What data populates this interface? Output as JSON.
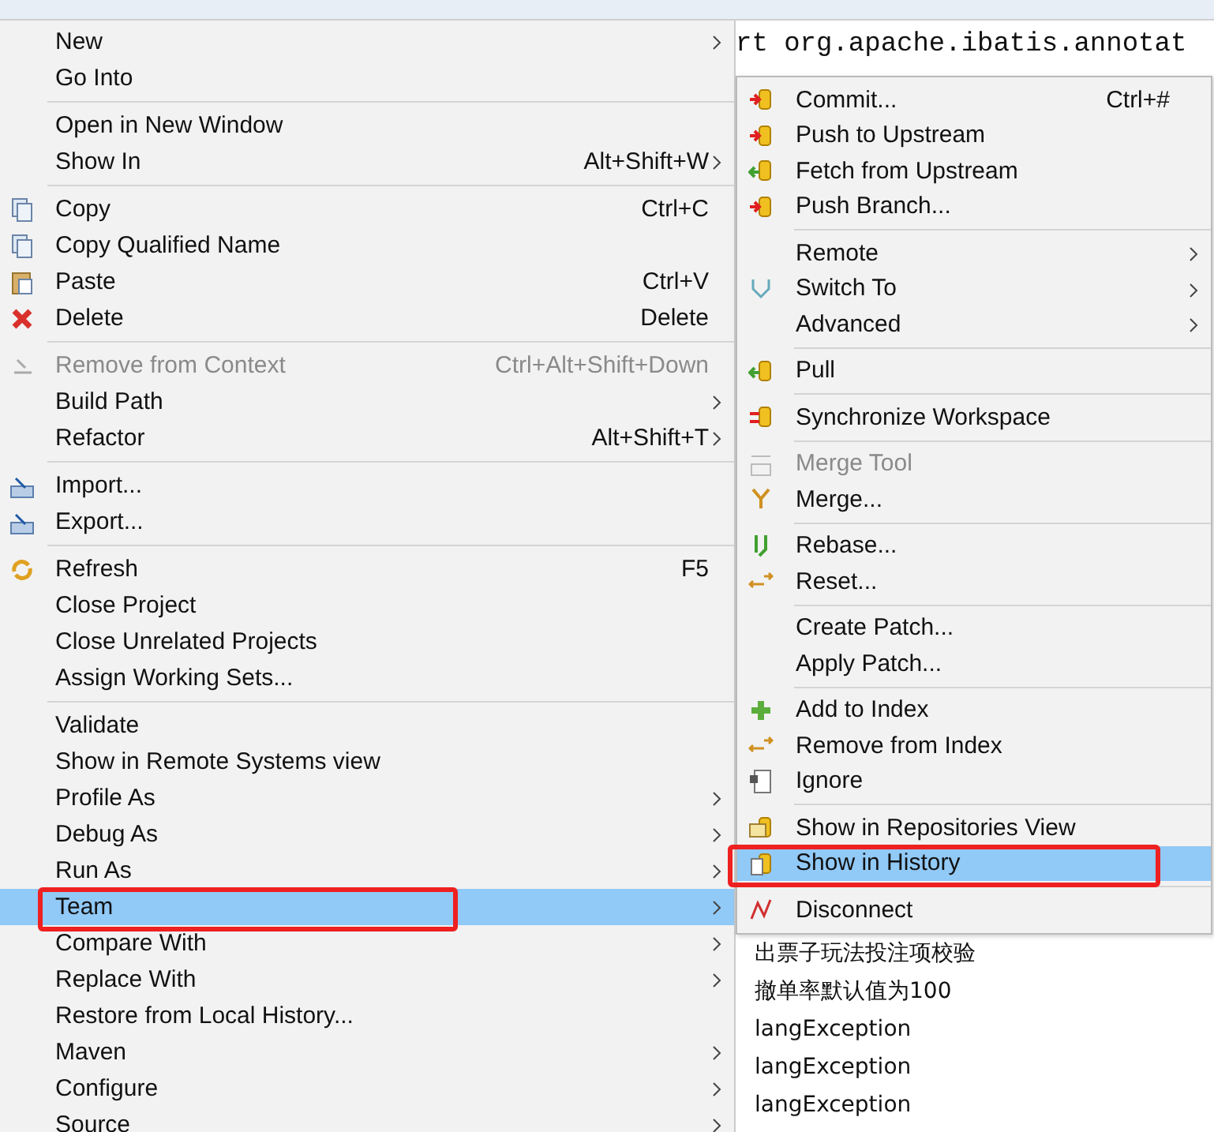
{
  "context_menu": {
    "groups": [
      [
        {
          "label": "New",
          "has_submenu": true,
          "disabled": false,
          "selected": false,
          "circled": false
        },
        {
          "label": "Go Into",
          "has_submenu": false,
          "disabled": false,
          "selected": false,
          "circled": false
        }
      ],
      [
        {
          "label": "Open in New Window",
          "has_submenu": false,
          "disabled": false,
          "selected": false,
          "circled": false
        },
        {
          "label": "Show In",
          "shortcut": "Alt+Shift+W",
          "has_submenu": true,
          "disabled": false,
          "selected": false,
          "circled": false
        }
      ],
      [
        {
          "label": "Copy",
          "shortcut": "Ctrl+C",
          "has_submenu": false,
          "disabled": false,
          "selected": false,
          "circled": false
        },
        {
          "label": "Copy Qualified Name",
          "has_submenu": false,
          "disabled": false,
          "selected": false,
          "circled": false
        },
        {
          "label": "Paste",
          "shortcut": "Ctrl+V",
          "has_submenu": false,
          "disabled": false,
          "selected": false,
          "circled": false
        },
        {
          "label": "Delete",
          "shortcut": "Delete",
          "has_submenu": false,
          "disabled": false,
          "selected": false,
          "circled": false
        }
      ],
      [
        {
          "label": "Remove from Context",
          "shortcut": "Ctrl+Alt+Shift+Down",
          "has_submenu": false,
          "disabled": true,
          "selected": false,
          "circled": false
        },
        {
          "label": "Build Path",
          "has_submenu": true,
          "disabled": false,
          "selected": false,
          "circled": false
        },
        {
          "label": "Refactor",
          "shortcut": "Alt+Shift+T",
          "has_submenu": true,
          "disabled": false,
          "selected": false,
          "circled": false
        }
      ],
      [
        {
          "label": "Import...",
          "has_submenu": false,
          "disabled": false,
          "selected": false,
          "circled": false
        },
        {
          "label": "Export...",
          "has_submenu": false,
          "disabled": false,
          "selected": false,
          "circled": false
        }
      ],
      [
        {
          "label": "Refresh",
          "shortcut": "F5",
          "has_submenu": false,
          "disabled": false,
          "selected": false,
          "circled": false
        },
        {
          "label": "Close Project",
          "has_submenu": false,
          "disabled": false,
          "selected": false,
          "circled": false
        },
        {
          "label": "Close Unrelated Projects",
          "has_submenu": false,
          "disabled": false,
          "selected": false,
          "circled": false
        },
        {
          "label": "Assign Working Sets...",
          "has_submenu": false,
          "disabled": false,
          "selected": false,
          "circled": false
        }
      ],
      [
        {
          "label": "Validate",
          "has_submenu": false,
          "disabled": false,
          "selected": false,
          "circled": false
        },
        {
          "label": "Show in Remote Systems view",
          "has_submenu": false,
          "disabled": false,
          "selected": false,
          "circled": false
        },
        {
          "label": "Profile As",
          "has_submenu": true,
          "disabled": false,
          "selected": false,
          "circled": false
        },
        {
          "label": "Debug As",
          "has_submenu": true,
          "disabled": false,
          "selected": false,
          "circled": false
        },
        {
          "label": "Run As",
          "has_submenu": true,
          "disabled": false,
          "selected": false,
          "circled": false
        },
        {
          "label": "Team",
          "has_submenu": true,
          "disabled": false,
          "selected": true,
          "circled": true
        },
        {
          "label": "Compare With",
          "has_submenu": true,
          "disabled": false,
          "selected": false,
          "circled": false
        },
        {
          "label": "Replace With",
          "has_submenu": true,
          "disabled": false,
          "selected": false,
          "circled": false
        },
        {
          "label": "Restore from Local History...",
          "has_submenu": false,
          "disabled": false,
          "selected": false,
          "circled": false
        },
        {
          "label": "Maven",
          "has_submenu": true,
          "disabled": false,
          "selected": false,
          "circled": false
        },
        {
          "label": "Configure",
          "has_submenu": true,
          "disabled": false,
          "selected": false,
          "circled": false
        },
        {
          "label": "Source",
          "has_submenu": true,
          "disabled": false,
          "selected": false,
          "circled": false
        }
      ]
    ]
  },
  "editor": {
    "code_line": "rt org.apache.ibatis.annotat"
  },
  "team_submenu": {
    "groups": [
      [
        {
          "label": "Commit...",
          "shortcut": "Ctrl+#",
          "has_submenu": false,
          "disabled": false,
          "selected": false,
          "circled": false
        },
        {
          "label": "Push to Upstream",
          "has_submenu": false,
          "disabled": false,
          "selected": false,
          "circled": false
        },
        {
          "label": "Fetch from Upstream",
          "has_submenu": false,
          "disabled": false,
          "selected": false,
          "circled": false
        },
        {
          "label": "Push Branch...",
          "has_submenu": false,
          "disabled": false,
          "selected": false,
          "circled": false
        }
      ],
      [
        {
          "label": "Remote",
          "has_submenu": true,
          "disabled": false,
          "selected": false,
          "circled": false
        },
        {
          "label": "Switch To",
          "has_submenu": true,
          "disabled": false,
          "selected": false,
          "circled": false
        },
        {
          "label": "Advanced",
          "has_submenu": true,
          "disabled": false,
          "selected": false,
          "circled": false
        }
      ],
      [
        {
          "label": "Pull",
          "has_submenu": false,
          "disabled": false,
          "selected": false,
          "circled": false
        }
      ],
      [
        {
          "label": "Synchronize Workspace",
          "has_submenu": false,
          "disabled": false,
          "selected": false,
          "circled": false
        }
      ],
      [
        {
          "label": "Merge Tool",
          "has_submenu": false,
          "disabled": true,
          "selected": false,
          "circled": false
        },
        {
          "label": "Merge...",
          "has_submenu": false,
          "disabled": false,
          "selected": false,
          "circled": false
        }
      ],
      [
        {
          "label": "Rebase...",
          "has_submenu": false,
          "disabled": false,
          "selected": false,
          "circled": false
        },
        {
          "label": "Reset...",
          "has_submenu": false,
          "disabled": false,
          "selected": false,
          "circled": false
        }
      ],
      [
        {
          "label": "Create Patch...",
          "has_submenu": false,
          "disabled": false,
          "selected": false,
          "circled": false
        },
        {
          "label": "Apply Patch...",
          "has_submenu": false,
          "disabled": false,
          "selected": false,
          "circled": false
        }
      ],
      [
        {
          "label": "Add to Index",
          "has_submenu": false,
          "disabled": false,
          "selected": false,
          "circled": false
        },
        {
          "label": "Remove from Index",
          "has_submenu": false,
          "disabled": false,
          "selected": false,
          "circled": false
        },
        {
          "label": "Ignore",
          "has_submenu": false,
          "disabled": false,
          "selected": false,
          "circled": false
        }
      ],
      [
        {
          "label": "Show in Repositories View",
          "has_submenu": false,
          "disabled": false,
          "selected": false,
          "circled": false
        },
        {
          "label": "Show in History",
          "has_submenu": false,
          "disabled": false,
          "selected": true,
          "circled": true
        }
      ],
      [
        {
          "label": "Disconnect",
          "has_submenu": false,
          "disabled": false,
          "selected": false,
          "circled": false
        }
      ]
    ]
  },
  "history_list": {
    "items": [
      "出票子玩法投注项校验",
      "撤单率默认值为100",
      "langException",
      "langException",
      "langException"
    ]
  }
}
